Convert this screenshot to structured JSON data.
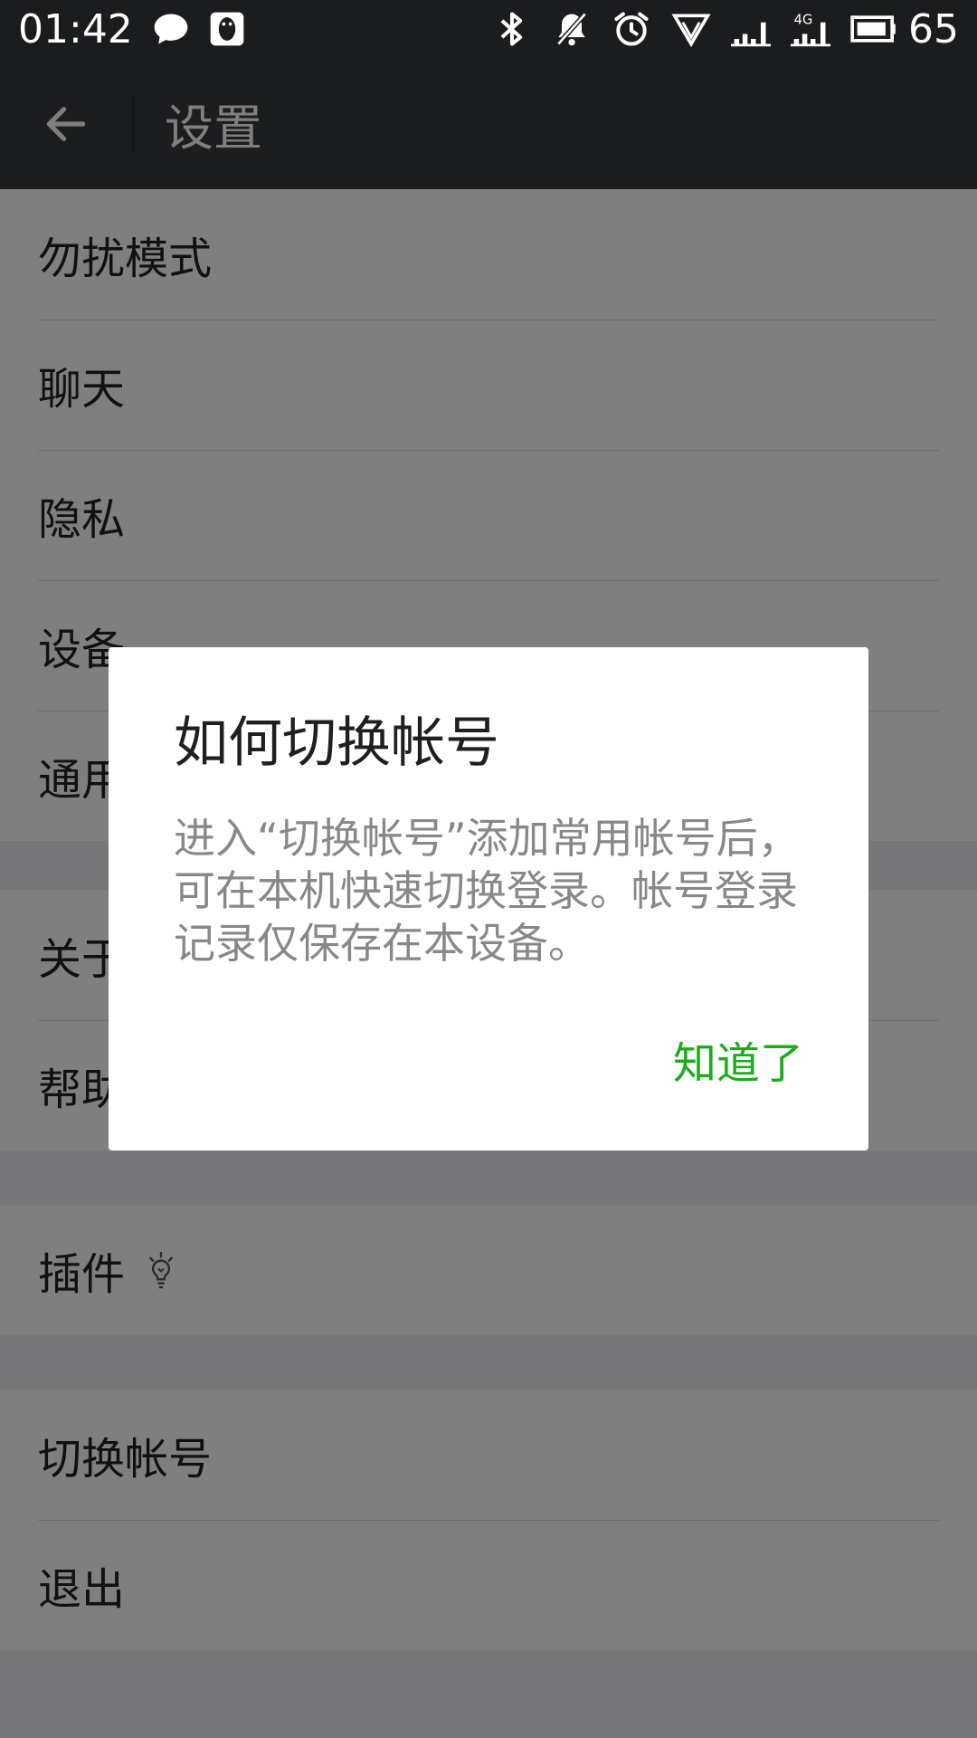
{
  "status_bar": {
    "time": "01:42",
    "battery": "65",
    "left_icons": [
      "chat-bubble-icon",
      "qq-penguin-icon"
    ],
    "right_icons": [
      "bluetooth-icon",
      "bell-off-icon",
      "alarm-icon",
      "vpn-icon",
      "signal-icon",
      "signal-4g-icon",
      "battery-icon"
    ]
  },
  "action_bar": {
    "title": "设置",
    "back_icon": "arrow-left-icon"
  },
  "settings": {
    "group1": [
      {
        "label": "勿扰模式"
      },
      {
        "label": "聊天"
      },
      {
        "label": "隐私"
      },
      {
        "label": "设备"
      },
      {
        "label": "通用"
      }
    ],
    "group2": [
      {
        "label": "关于微信"
      },
      {
        "label": "帮助与反馈"
      }
    ],
    "group3": [
      {
        "label": "插件",
        "icon": "lightbulb-icon"
      }
    ],
    "group4": [
      {
        "label": "切换帐号"
      },
      {
        "label": "退出"
      }
    ]
  },
  "dialog": {
    "title": "如何切换帐号",
    "message": "进入“切换帐号”添加常用帐号后，可在本机快速切换登录。帐号登录记录仅保存在本设备。",
    "confirm_label": "知道了"
  },
  "colors": {
    "status_bar_bg": "#1b1c1e",
    "action_bar_bg": "#393a3f",
    "accent_green": "#1aad19",
    "page_bg": "#efeff4"
  }
}
